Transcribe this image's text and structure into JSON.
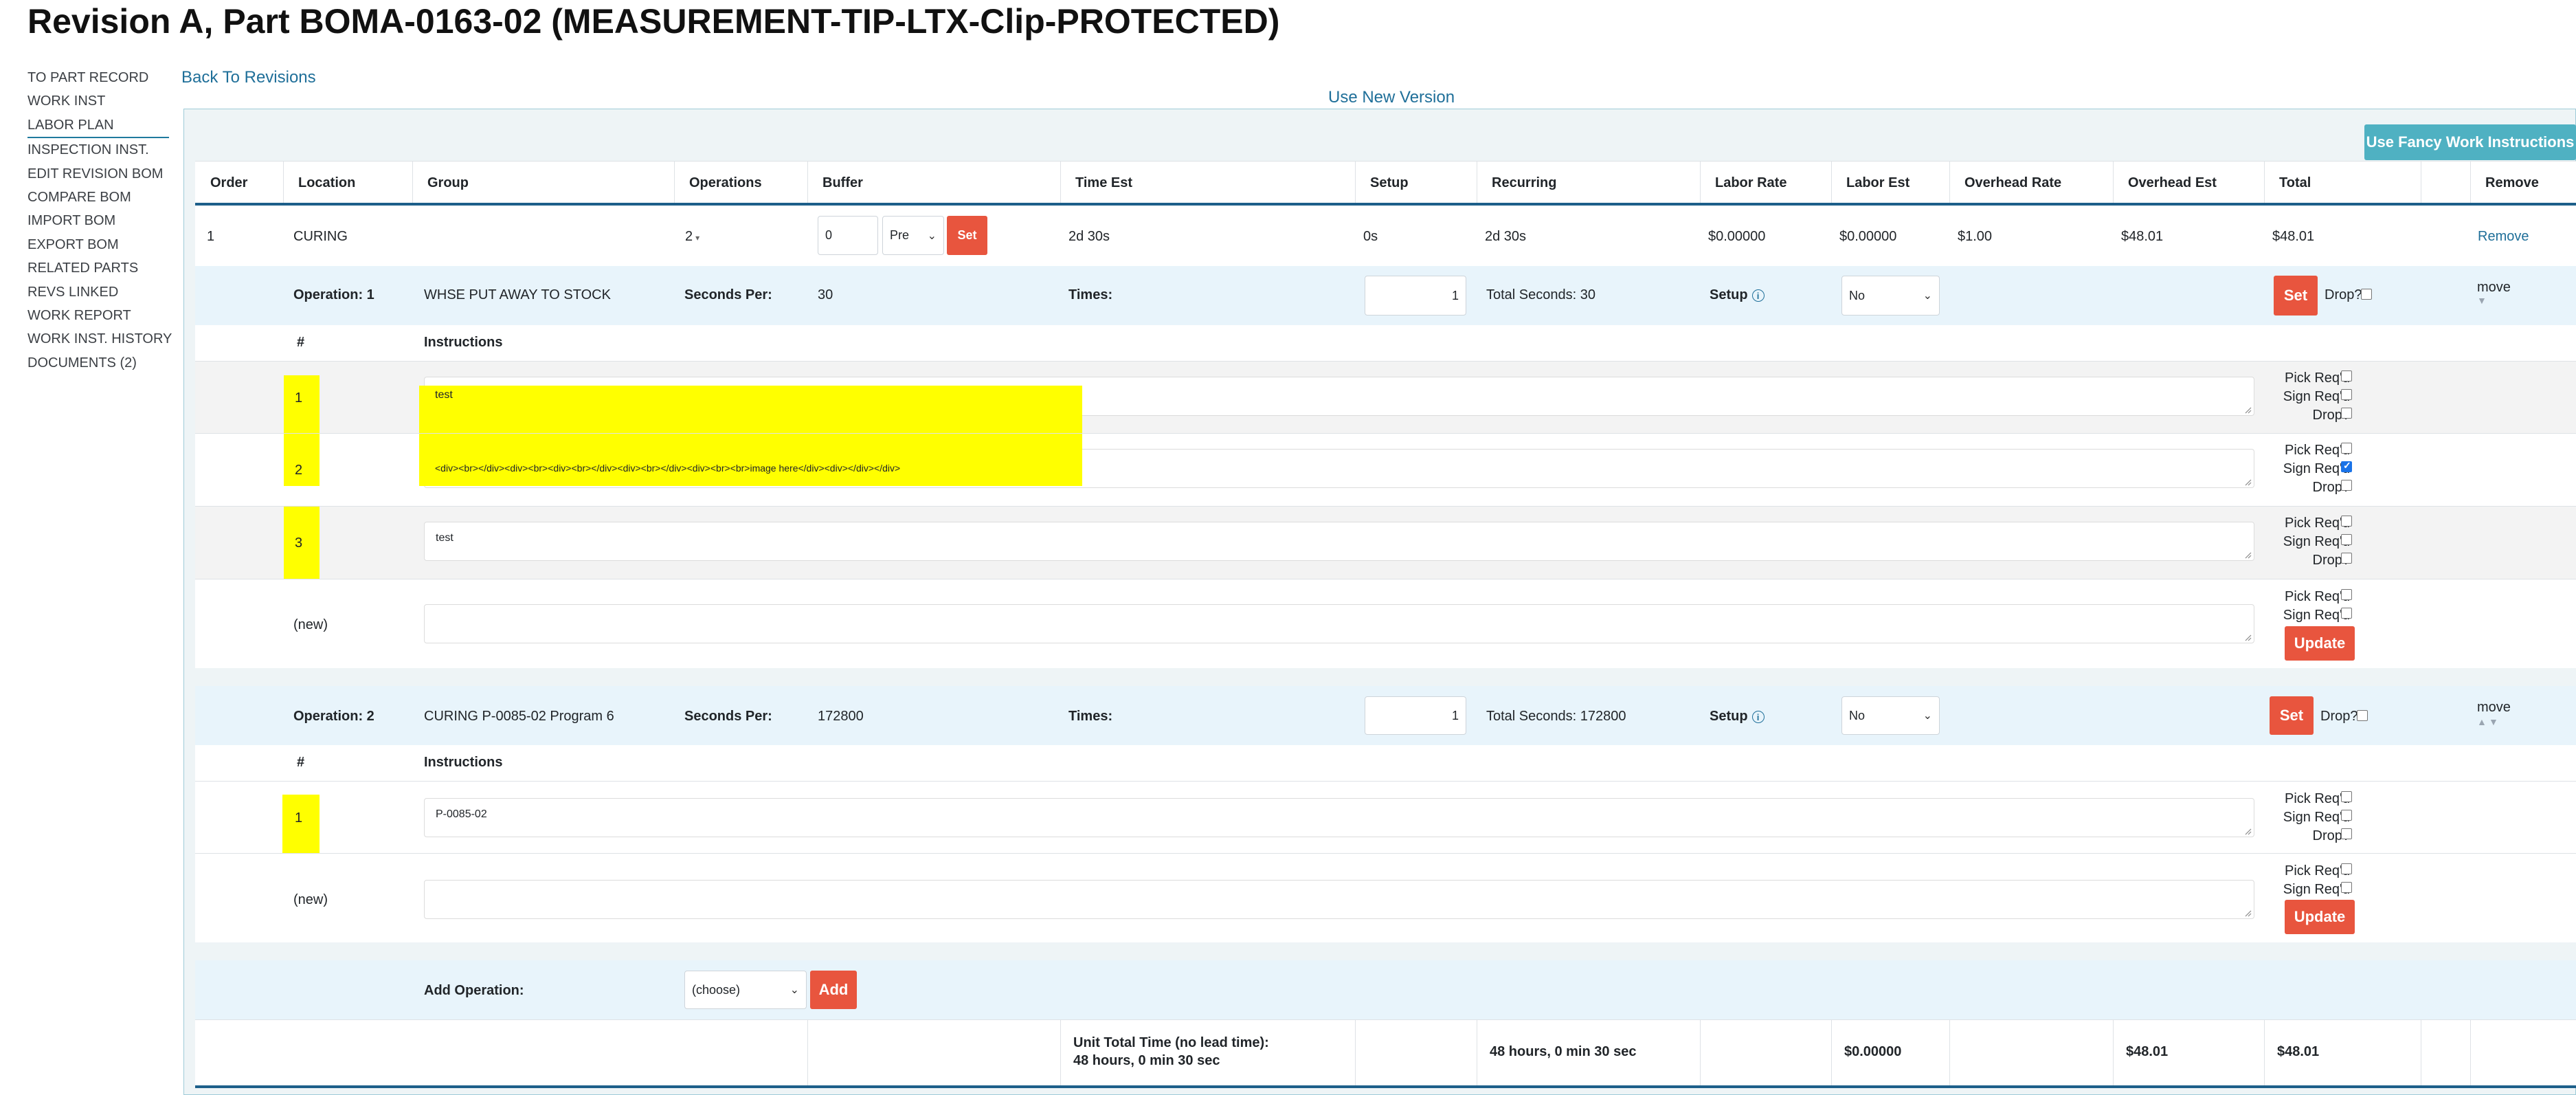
{
  "title": "Revision A, Part BOMA-0163-02 (MEASUREMENT-TIP-LTX-Clip-PROTECTED)",
  "sidebar": {
    "items": [
      "TO PART RECORD",
      "WORK INST",
      "LABOR PLAN",
      "INSPECTION INST.",
      "EDIT REVISION BOM",
      "COMPARE BOM",
      "IMPORT BOM",
      "EXPORT BOM",
      "RELATED PARTS",
      "REVS LINKED",
      "WORK REPORT",
      "WORK INST. HISTORY",
      "DOCUMENTS (2)"
    ],
    "active": "LABOR PLAN"
  },
  "links": {
    "back": "Back To Revisions",
    "new_version": "Use New Version"
  },
  "buttons": {
    "fancy": "Use Fancy Work Instructions",
    "set": "Set",
    "update": "Update",
    "add": "Add"
  },
  "table": {
    "headers": [
      "Order",
      "Location",
      "Group",
      "Operations",
      "Buffer",
      "Time Est",
      "Setup",
      "Recurring",
      "Labor Rate",
      "Labor Est",
      "Overhead Rate",
      "Overhead Est",
      "Total",
      "Remove"
    ],
    "row": {
      "order": "1",
      "location": "CURING",
      "operations": "2",
      "buffer_value": "0",
      "buffer_mode": "Pre",
      "time_est": "2d 30s",
      "setup": "0s",
      "recurring": "2d 30s",
      "labor_rate": "$0.00000",
      "labor_est": "$0.00000",
      "overhead_rate": "$1.00",
      "overhead_est": "$48.01",
      "total": "$48.01",
      "remove": "Remove"
    }
  },
  "labels": {
    "seconds_per": "Seconds Per:",
    "times": "Times:",
    "setup": "Setup",
    "drop": "Drop?",
    "move": "move",
    "hash": "#",
    "instructions": "Instructions",
    "pick": "Pick Req'd",
    "sign": "Sign Req'd",
    "new": "(new)",
    "add_operation": "Add Operation:",
    "choose": "(choose)"
  },
  "op1": {
    "label": "Operation: 1",
    "name": "WHSE PUT AWAY TO STOCK",
    "seconds": "30",
    "times": "1",
    "total_seconds": "Total Seconds: 30",
    "setup_value": "No",
    "instructions": [
      {
        "num": "1",
        "text": "test"
      },
      {
        "num": "2",
        "text": "<div><br></div><div><br><div><br></div><div><br></div><div><br><br>image here</div><div></div></div>"
      },
      {
        "num": "3",
        "text": "test"
      }
    ]
  },
  "op2": {
    "label": "Operation: 2",
    "name": "CURING P-0085-02 Program 6",
    "seconds": "172800",
    "times": "1",
    "total_seconds": "Total Seconds: 172800",
    "setup_value": "No",
    "instructions": [
      {
        "num": "1",
        "text": "P-0085-02"
      }
    ]
  },
  "footer": {
    "unit_total_label": "Unit Total Time (no lead time):",
    "unit_total_value": "48 hours, 0 min 30 sec",
    "recurring": "48 hours, 0 min 30 sec",
    "labor_est": "$0.00000",
    "overhead_est": "$48.01",
    "total": "$48.01"
  },
  "colors": {
    "accent_red": "#e8553e",
    "teal_button": "#4fb1c2",
    "link_blue": "#1f6f99",
    "highlight": "#ffff00"
  }
}
